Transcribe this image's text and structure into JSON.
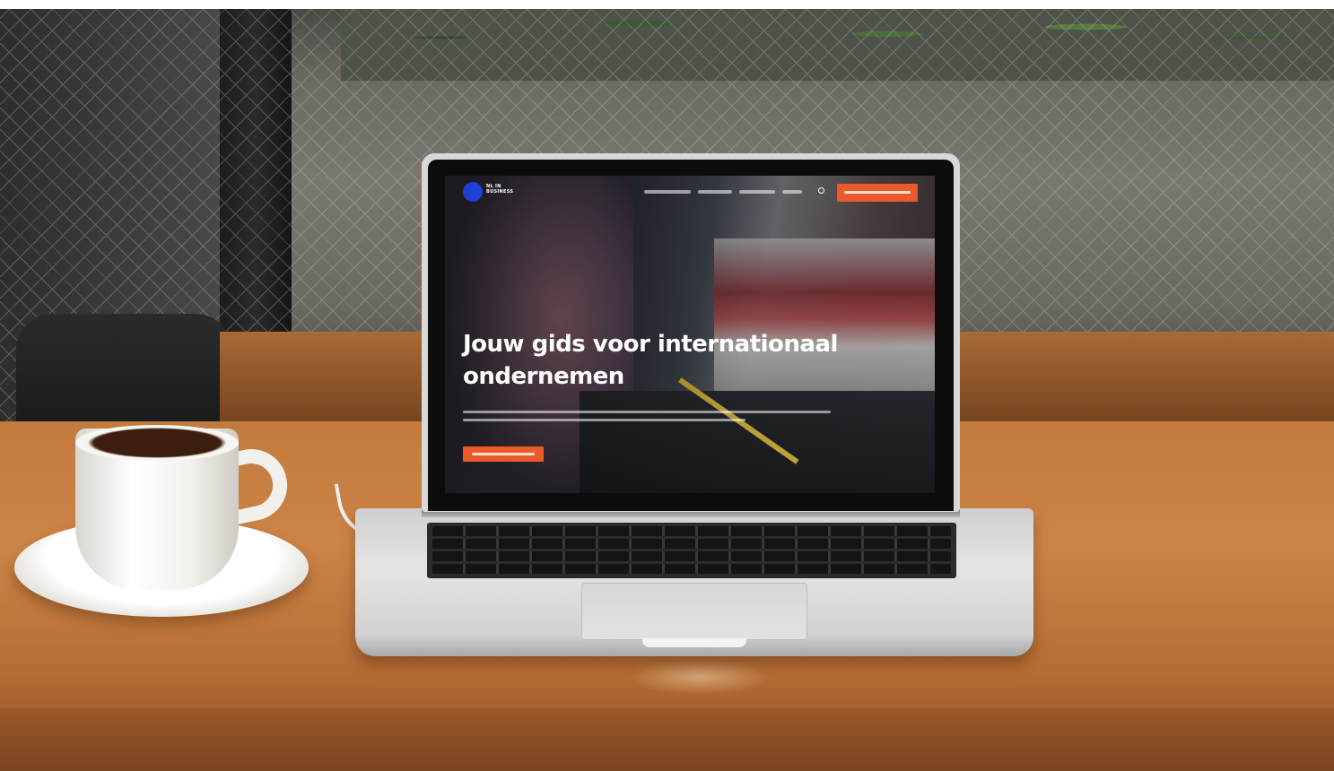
{
  "photo": {
    "subject": "laptop-on-cafe-table",
    "colors": {
      "wood": "#c27a3e",
      "accent": "#ec5a2c",
      "logo": "#1f3fd6"
    }
  },
  "website": {
    "brand": "NL IN\nBUSINESS",
    "hero_title": "Jouw gids voor internationaal ondernemen"
  }
}
